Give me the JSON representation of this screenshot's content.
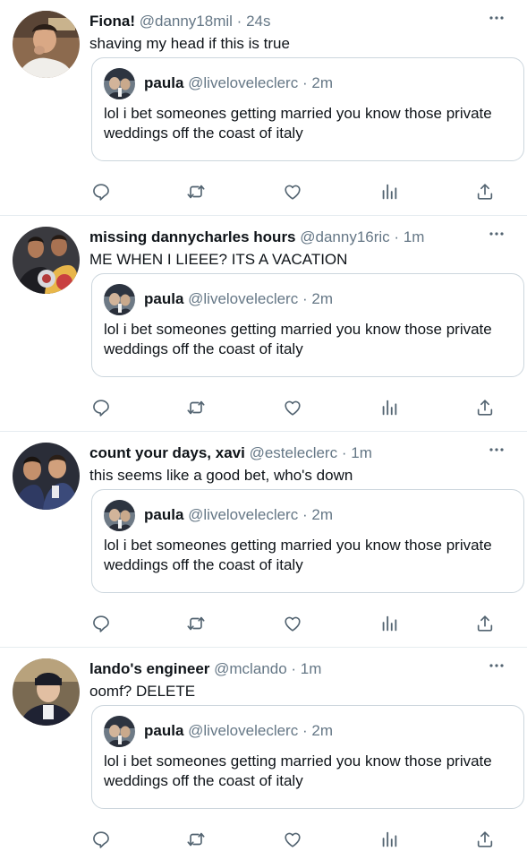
{
  "colors": {
    "text": "#0f1419",
    "secondary": "#657786",
    "border": "#ccd6dd",
    "divider": "#e6ecf0",
    "icon": "#536471"
  },
  "icons": [
    "more-icon",
    "reply-icon",
    "retweet-icon",
    "like-icon",
    "analytics-icon",
    "share-icon"
  ],
  "tweets": [
    {
      "name": "Fiona!",
      "handle": "@danny18mil",
      "sep": "·",
      "time": "24s",
      "text": "shaving my head if this is true",
      "quote": {
        "name": "paula",
        "handle": "@liveloveleclerc",
        "sep": "·",
        "time": "2m",
        "text": "lol i bet someones getting married you know those private weddings off the coast of italy"
      }
    },
    {
      "name": "missing dannycharles hours",
      "handle": "@danny16ric",
      "sep": "·",
      "time": "1m",
      "text": "ME WHEN I LIEEE? ITS A VACATION",
      "quote": {
        "name": "paula",
        "handle": "@liveloveleclerc",
        "sep": "·",
        "time": "2m",
        "text": "lol i bet someones getting married you know those private weddings off the coast of italy"
      }
    },
    {
      "name": "count your days, xavi",
      "handle": "@esteleclerc",
      "sep": "·",
      "time": "1m",
      "text": "this seems like a good bet, who's down",
      "quote": {
        "name": "paula",
        "handle": "@liveloveleclerc",
        "sep": "·",
        "time": "2m",
        "text": "lol i bet someones getting married you know those private weddings off the coast of italy"
      }
    },
    {
      "name": "lando's engineer",
      "handle": "@mclando",
      "sep": "·",
      "time": "1m",
      "text": "oomf? DELETE",
      "quote": {
        "name": "paula",
        "handle": "@liveloveleclerc",
        "sep": "·",
        "time": "2m",
        "text": "lol i bet someones getting married you know those private weddings off the coast of italy"
      }
    }
  ]
}
